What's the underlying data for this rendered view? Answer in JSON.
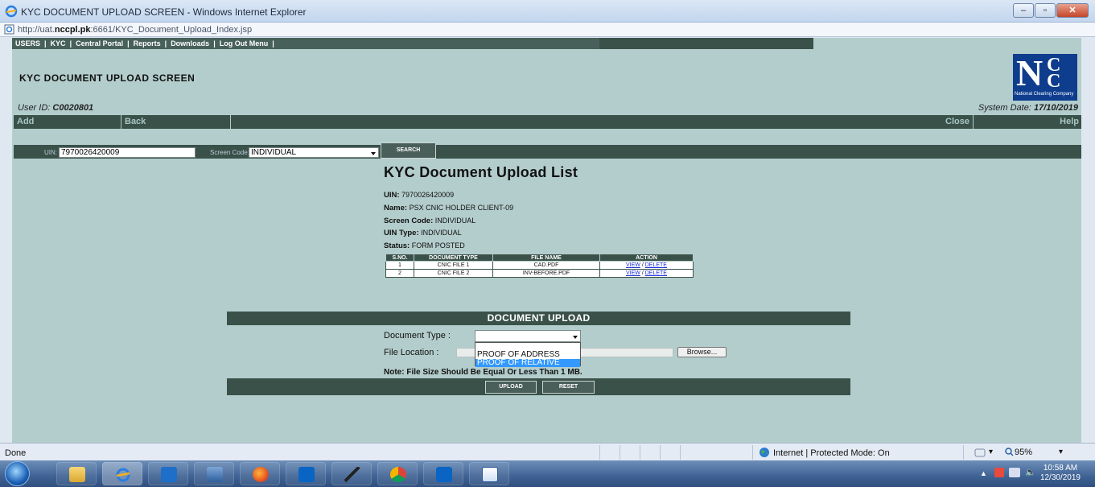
{
  "window": {
    "title": "KYC DOCUMENT UPLOAD SCREEN - Windows Internet Explorer",
    "url_prefix": "http://uat.",
    "url_host": "nccpl.pk",
    "url_rest": ":6661/KYC_Document_Upload_Index.jsp",
    "btn_min": "‒",
    "btn_max": "▫",
    "btn_close": "✕"
  },
  "menu": {
    "items": [
      "USERS",
      "KYC",
      "Central Portal",
      "Reports",
      "Downloads",
      "Log Out Menu"
    ],
    "sep": "|"
  },
  "header": {
    "page_title": "KYC DOCUMENT UPLOAD SCREEN",
    "user_id_label": "User ID:",
    "user_id": "C0020801",
    "system_date_label": "System Date:",
    "system_date": "17/10/2019",
    "logo_n": "N",
    "logo_c": "C",
    "logo_sub": "National Clearing Company"
  },
  "actions": {
    "add": "Add",
    "back": "Back",
    "close": "Close",
    "help": "Help"
  },
  "search": {
    "uin_label": "UIN:",
    "uin_value": "7970026420009",
    "screen_code_label": "Screen Code:",
    "screen_code_value": "INDIVIDUAL",
    "search_button": "SEARCH"
  },
  "list": {
    "title": "KYC Document Upload List",
    "uin_label": "UIN:",
    "uin": "7970026420009",
    "name_label": "Name:",
    "name": "PSX CNIC HOLDER CLIENT-09",
    "screen_code_label": "Screen Code:",
    "screen_code": "INDIVIDUAL",
    "uin_type_label": "UIN Type:",
    "uin_type": "INDIVIDUAL",
    "status_label": "Status:",
    "status": "FORM POSTED",
    "columns": [
      "S.NO.",
      "DOCUMENT TYPE",
      "FILE NAME",
      "ACTION"
    ],
    "rows": [
      {
        "sno": "1",
        "doc_type": "CNIC FILE 1",
        "file_name": "CAD.PDF",
        "view": "VIEW",
        "slash": "/",
        "delete": "DELETE"
      },
      {
        "sno": "2",
        "doc_type": "CNIC FILE 2",
        "file_name": "INV-BEFORE.PDF",
        "view": "VIEW",
        "slash": "/",
        "delete": "DELETE"
      }
    ]
  },
  "upload": {
    "header": "DOCUMENT UPLOAD",
    "doc_type_label": "Document Type :",
    "doc_type_value": "",
    "doc_type_options": [
      "",
      "PROOF OF ADDRESS",
      "PROOF OF RELATIVE"
    ],
    "file_location_label": "File Location :",
    "browse_button": "Browse...",
    "note": "Note: File Size Should Be Equal Or Less Than 1 MB.",
    "upload_button": "UPLOAD",
    "reset_button": "RESET"
  },
  "status": {
    "left": "Done",
    "zone": "Internet | Protected Mode: On",
    "zoom": "95%",
    "zoom_arrow": "▾",
    "zone_arrow": "▾"
  },
  "taskbar": {
    "time": "10:58 AM",
    "date": "12/30/2019"
  }
}
